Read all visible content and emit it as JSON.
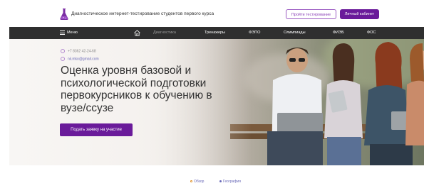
{
  "header": {
    "site_title": "Диагностическое интернет-тестирование студентов первого курса",
    "take_test_label": "Пройти тестирование",
    "cabinet_label": "Личный кабинет"
  },
  "nav": {
    "menu_label": "Меню",
    "items": [
      "Диагностика",
      "Тренажеры",
      "ФЭПО",
      "Олимпиады",
      "ФИЭБ",
      "ФОС"
    ]
  },
  "hero": {
    "phone": "+7 8362 42-24-68",
    "email": "nii.mko@gmail.com",
    "title": "Оценка уровня базовой и психологической подготовки первокурсников к обучению в вузе/ссузе",
    "cta_label": "Подать заявку на участие"
  },
  "tabs": [
    "Обзор",
    "География"
  ],
  "colors": {
    "accent": "#6a1b9a",
    "nav_bg": "#2f2f2f",
    "link": "#6a6ab8"
  }
}
